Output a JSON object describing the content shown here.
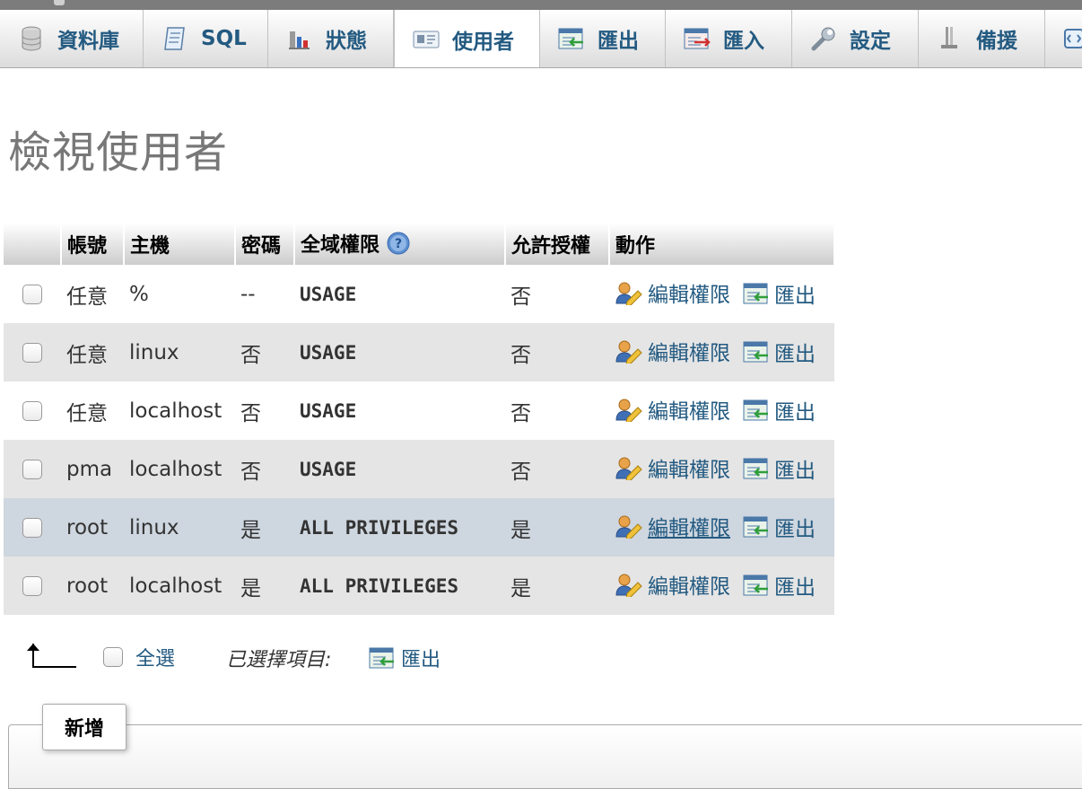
{
  "tabs": [
    {
      "label": "資料庫",
      "icon": "database-icon"
    },
    {
      "label": "SQL",
      "icon": "sql-scroll-icon"
    },
    {
      "label": "狀態",
      "icon": "status-chart-icon"
    },
    {
      "label": "使用者",
      "icon": "users-card-icon",
      "active": true
    },
    {
      "label": "匯出",
      "icon": "export-icon"
    },
    {
      "label": "匯入",
      "icon": "import-icon"
    },
    {
      "label": "設定",
      "icon": "wrench-icon"
    },
    {
      "label": "備援",
      "icon": "replication-icon"
    }
  ],
  "page_title": "檢視使用者",
  "table": {
    "headers": {
      "user": "帳號",
      "host": "主機",
      "password": "密碼",
      "global_privileges": "全域權限",
      "grant": "允許授權",
      "action": "動作"
    },
    "rows": [
      {
        "user": "任意",
        "host": "%",
        "password": "--",
        "privileges": "USAGE",
        "grant": "否"
      },
      {
        "user": "任意",
        "host": "linux",
        "password": "否",
        "privileges": "USAGE",
        "grant": "否"
      },
      {
        "user": "任意",
        "host": "localhost",
        "password": "否",
        "privileges": "USAGE",
        "grant": "否"
      },
      {
        "user": "pma",
        "host": "localhost",
        "password": "否",
        "privileges": "USAGE",
        "grant": "否"
      },
      {
        "user": "root",
        "host": "linux",
        "password": "是",
        "privileges": "ALL PRIVILEGES",
        "grant": "是"
      },
      {
        "user": "root",
        "host": "localhost",
        "password": "是",
        "privileges": "ALL PRIVILEGES",
        "grant": "是"
      }
    ],
    "actions": {
      "edit": "編輯權限",
      "export": "匯出"
    }
  },
  "bottom": {
    "check_all": "全選",
    "with_selected": "已選擇項目:",
    "export": "匯出"
  },
  "add_fieldset": {
    "legend": "新增"
  },
  "colors": {
    "link": "#235a81",
    "warning_red": "#e00000",
    "row_alt": "#e5e5e5",
    "row_hover": "#ced6df"
  }
}
